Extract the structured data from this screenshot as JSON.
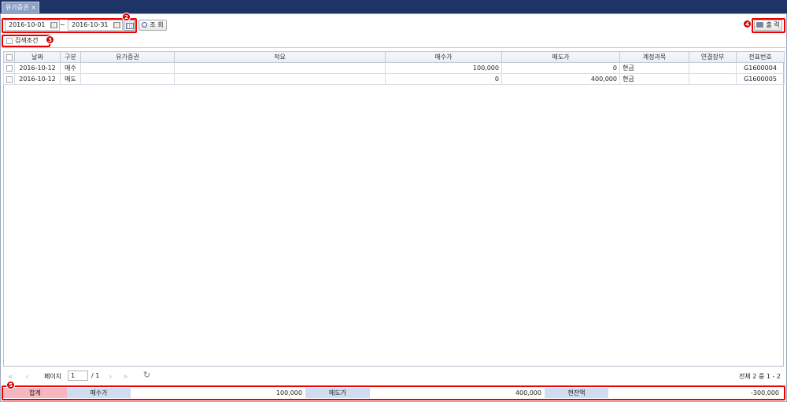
{
  "tab": {
    "title": "유가증권",
    "close": "×"
  },
  "filter": {
    "start_date": "2016-10-01",
    "separator": "~",
    "end_date": "2016-10-31",
    "search_button": "조 회",
    "print_button": "출 력",
    "search_condition_label": "검색조건"
  },
  "badges": {
    "b2": "2",
    "b3": "3",
    "b4": "4",
    "b5": "5"
  },
  "table": {
    "headers": [
      "날짜",
      "구분",
      "유가증권",
      "적요",
      "매수가",
      "매도가",
      "계정과목",
      "연결장부",
      "전표번호"
    ],
    "rows": [
      {
        "date": "2016-10-12",
        "type": "매수",
        "security": "",
        "memo": "",
        "buy": "100,000",
        "sell": "0",
        "account": "현금",
        "linked": "",
        "voucher": "G1600004"
      },
      {
        "date": "2016-10-12",
        "type": "매도",
        "security": "",
        "memo": "",
        "buy": "0",
        "sell": "400,000",
        "account": "현금",
        "linked": "",
        "voucher": "G1600005"
      }
    ]
  },
  "pager": {
    "page_label": "페이지",
    "current_page": "1",
    "total_pages": "/ 1",
    "info": "전체 2 중 1 - 2"
  },
  "totals": {
    "sum_label": "합계",
    "buy_label": "매수가",
    "buy_value": "100,000",
    "sell_label": "매도가",
    "sell_value": "400,000",
    "balance_label": "현잔액",
    "balance_value": "-300,000"
  },
  "colors": {
    "titlebar": "#1e3466",
    "marker": "#e00000",
    "sum_bg": "#f5b6c0",
    "label_bg": "#cfdcf2"
  }
}
